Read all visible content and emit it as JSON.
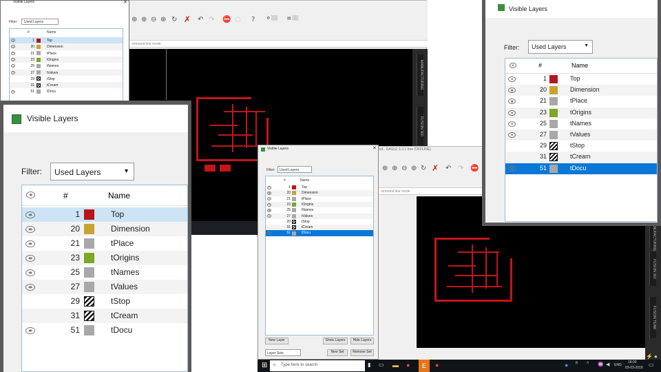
{
  "dialog": {
    "title": "Visible Layers",
    "filter_label": "Filter:",
    "filter_value": "Used Layers",
    "col_num": "#",
    "col_name": "Name",
    "layers": [
      {
        "num": "1",
        "name": "Top",
        "color": "#b5151b",
        "pattern": "solid",
        "visible": true
      },
      {
        "num": "20",
        "name": "Dimension",
        "color": "#c9a234",
        "pattern": "solid",
        "visible": true
      },
      {
        "num": "21",
        "name": "tPlace",
        "color": "#a8a8a8",
        "pattern": "solid",
        "visible": true
      },
      {
        "num": "23",
        "name": "tOrigins",
        "color": "#7aa823",
        "pattern": "solid",
        "visible": true
      },
      {
        "num": "25",
        "name": "tNames",
        "color": "#a8a8a8",
        "pattern": "solid",
        "visible": true
      },
      {
        "num": "27",
        "name": "tValues",
        "color": "#a8a8a8",
        "pattern": "solid",
        "visible": true
      },
      {
        "num": "29",
        "name": "tStop",
        "color": "#111111",
        "pattern": "hatch",
        "visible": false
      },
      {
        "num": "31",
        "name": "tCream",
        "color": "#111111",
        "pattern": "hatch",
        "visible": false
      },
      {
        "num": "51",
        "name": "tDocu",
        "color": "#a8a8a8",
        "pattern": "solid",
        "visible": true
      }
    ],
    "buttons": {
      "new_layer": "New Layer",
      "show_layers": "Show Layers",
      "hide_layers": "Hide Layers",
      "layer_sets": "Layer Sets",
      "new_set": "New Set",
      "remove_set": "Remove Set"
    }
  },
  "eagle": {
    "title": "...brd - EAGLE 9.3.1 free (OFFLINE)",
    "command_hint": "ommand line mode",
    "side_tabs": [
      "MANUFACTURING",
      "FUSION 360",
      "FUSION TEAM"
    ]
  },
  "taskbar": {
    "search_placeholder": "Type here to search",
    "lang": "ENG",
    "time": "18:00",
    "date": "03-03-2019"
  },
  "colors": {
    "selection": "#0a78d7",
    "trace": "#c2151b",
    "board_bg": "#000000",
    "window_border": "#5a5a5a"
  }
}
